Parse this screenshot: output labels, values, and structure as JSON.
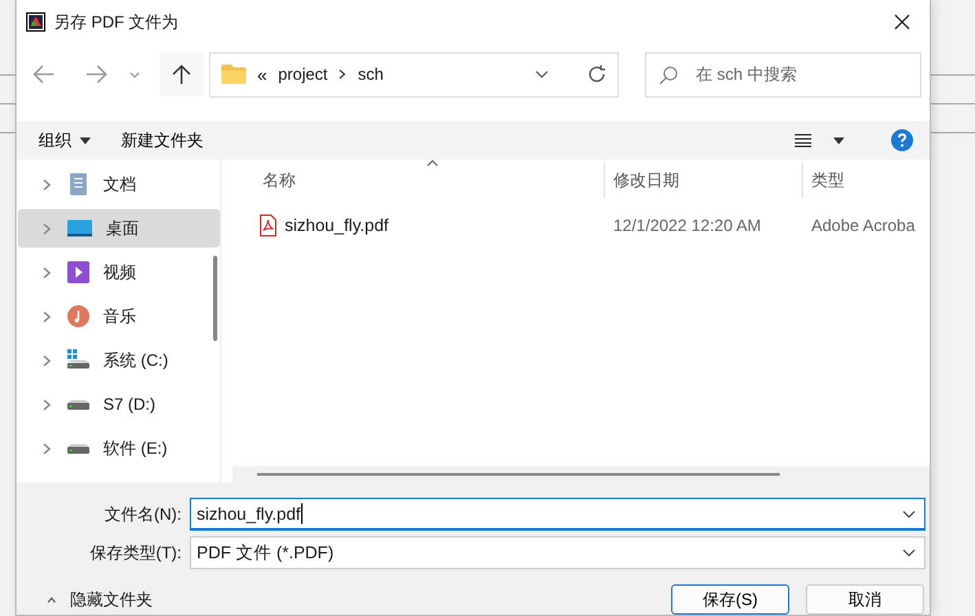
{
  "window": {
    "title": "另存 PDF 文件为"
  },
  "address": {
    "overflow": "«",
    "path": [
      "project",
      "sch"
    ]
  },
  "search": {
    "placeholder": "在 sch 中搜索"
  },
  "toolbar": {
    "organize": "组织",
    "new_folder": "新建文件夹"
  },
  "sidebar": {
    "items": [
      {
        "label": "文档",
        "kind": "documents",
        "selected": false
      },
      {
        "label": "桌面",
        "kind": "desktop",
        "selected": true
      },
      {
        "label": "视频",
        "kind": "videos",
        "selected": false
      },
      {
        "label": "音乐",
        "kind": "music",
        "selected": false
      },
      {
        "label": "系统 (C:)",
        "kind": "system-drive",
        "selected": false
      },
      {
        "label": "S7 (D:)",
        "kind": "drive",
        "selected": false
      },
      {
        "label": "软件 (E:)",
        "kind": "drive",
        "selected": false
      }
    ]
  },
  "table": {
    "columns": [
      {
        "label": "名称",
        "sorted": true
      },
      {
        "label": "修改日期",
        "sorted": false
      },
      {
        "label": "类型",
        "sorted": false
      }
    ],
    "rows": [
      {
        "name": "sizhou_fly.pdf",
        "date": "12/1/2022 12:20 AM",
        "type": "Adobe Acroba"
      }
    ]
  },
  "filename": {
    "label": "文件名(N):",
    "value": "sizhou_fly.pdf"
  },
  "filetype": {
    "label": "保存类型(T):",
    "value": "PDF 文件 (*.PDF)"
  },
  "hide_folders": "隐藏文件夹",
  "buttons": [
    {
      "label": "保存(S)",
      "default": true
    },
    {
      "label": "取消",
      "default": false
    }
  ]
}
